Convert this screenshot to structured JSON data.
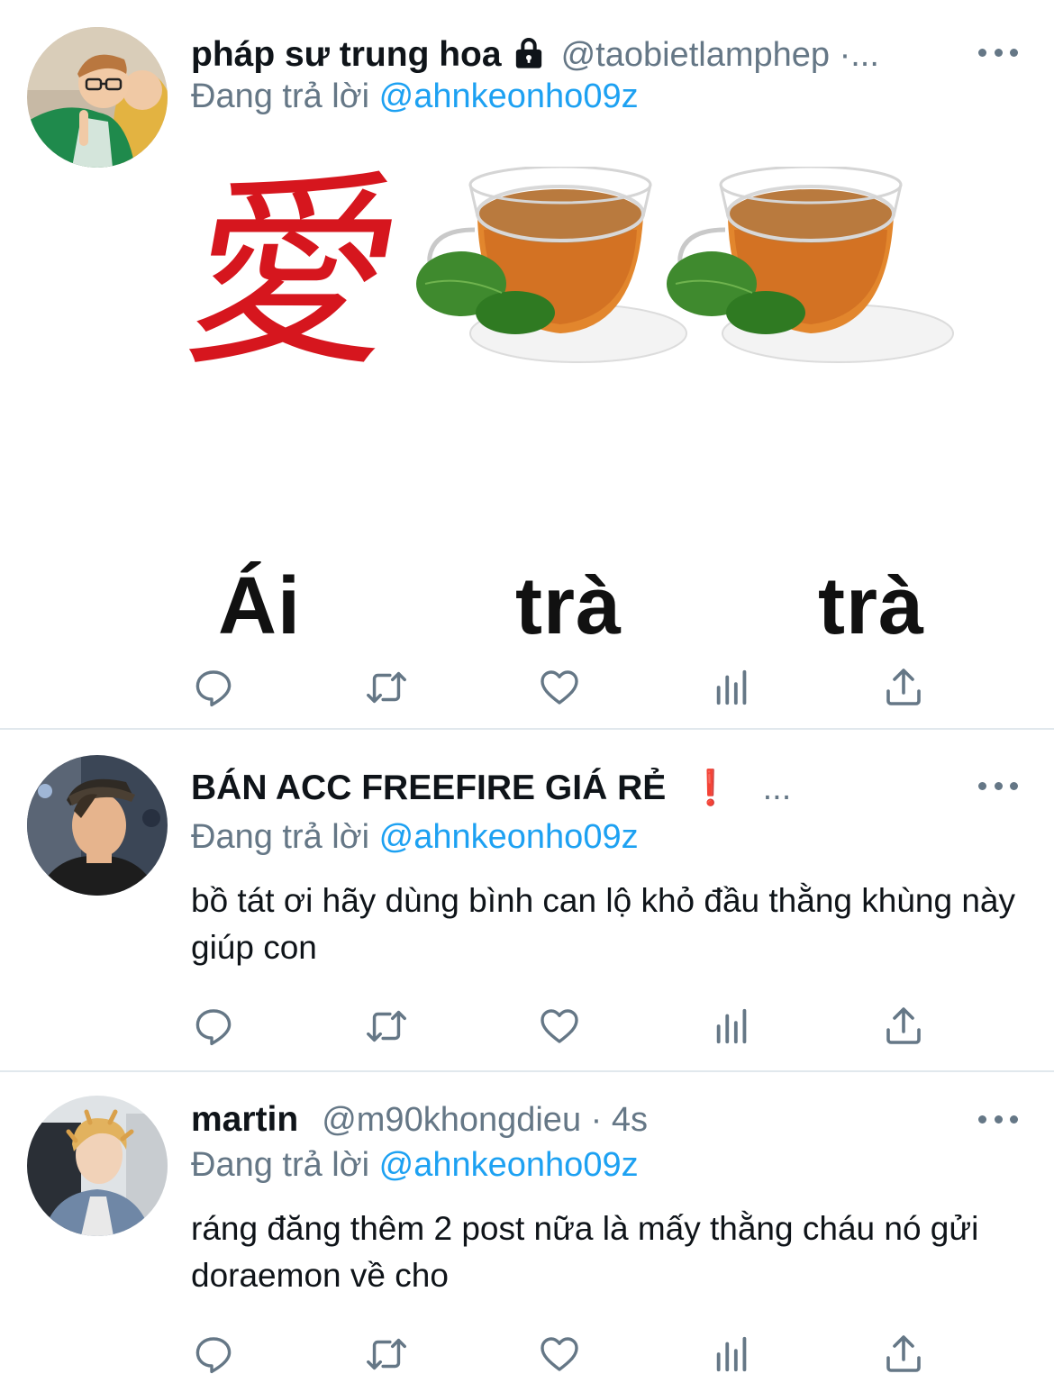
{
  "tweets": [
    {
      "name": "pháp sư trung hoa",
      "handle": "@taobietlamphep ·...",
      "reply_label": "Đang trả lời",
      "reply_mention": "@ahnkeonho09z",
      "media_char": "愛",
      "media_captions": [
        "Ái",
        "trà",
        "trà"
      ]
    },
    {
      "name": "BÁN ACC FREEFIRE GIÁ RẺ",
      "badge": "❗",
      "trailing": "...",
      "reply_label": "Đang trả lời",
      "reply_mention": "@ahnkeonho09z",
      "text": "bồ tát ơi hãy dùng bình can lộ khỏ đầu thằng khùng này giúp con"
    },
    {
      "name": "martin",
      "handle": "@m90khongdieu · 4s",
      "reply_label": "Đang trả lời",
      "reply_mention": "@ahnkeonho09z",
      "text": "ráng đăng thêm 2 post nữa là mấy thằng cháu nó gửi doraemon về cho"
    }
  ],
  "colors": {
    "secondary_text": "#657786",
    "mention": "#1da1f2",
    "divider": "#e1e8ed",
    "badge": "#e0245e"
  },
  "icons": [
    "reply-icon",
    "retweet-icon",
    "like-icon",
    "analytics-icon",
    "share-icon",
    "lock-icon",
    "more-icon"
  ]
}
